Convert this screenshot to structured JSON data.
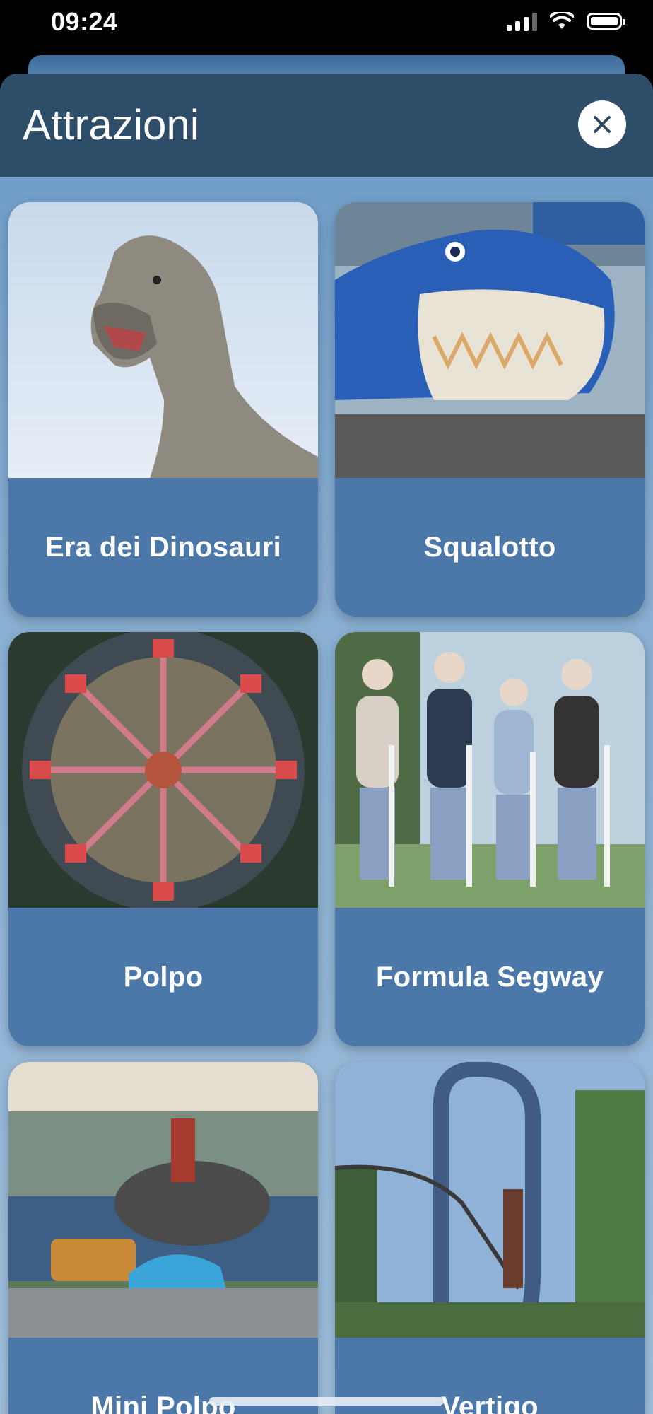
{
  "status_bar": {
    "time": "09:24"
  },
  "modal": {
    "title": "Attrazioni",
    "close_icon": "close-icon"
  },
  "attractions": [
    {
      "name": "Era dei Dinosauri",
      "image": "dinosaur-photo"
    },
    {
      "name": "Squalotto",
      "image": "shark-coaster-photo"
    },
    {
      "name": "Polpo",
      "image": "octopus-ride-photo"
    },
    {
      "name": "Formula Segway",
      "image": "segway-group-photo"
    },
    {
      "name": "Mini Polpo",
      "image": "mini-octopus-ride-photo"
    },
    {
      "name": "Vertigo",
      "image": "loop-coaster-photo"
    }
  ]
}
